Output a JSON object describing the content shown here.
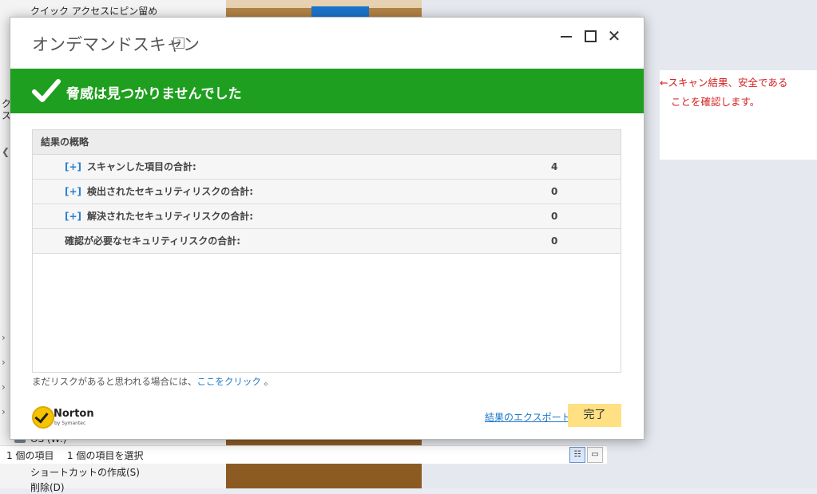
{
  "background": {
    "explorer_items": [
      "クイック アクセスにピン留め",
      "ク",
      "ス",
      "ショートカットの作成(S)",
      "削除(D)"
    ],
    "drive_label": "OS (W:)",
    "status_bar": {
      "item_count": "1 個の項目",
      "selected": "1 個の項目を選択"
    }
  },
  "annotation": {
    "line1": "←スキャン結果、安全である",
    "line2": "ことを確認します。"
  },
  "dialog": {
    "title": "オンデマンドスキャン",
    "help": "?",
    "close": "✕",
    "banner_text": "脅威は見つかりませんでした",
    "summary": {
      "header": "結果の概略",
      "rows": [
        {
          "expander": "[+]",
          "label": "スキャンした項目の合計:",
          "value": "4"
        },
        {
          "expander": "[+]",
          "label": "検出されたセキュリティリスクの合計:",
          "value": "0"
        },
        {
          "expander": "[+]",
          "label": "解決されたセキュリティリスクの合計:",
          "value": "0"
        },
        {
          "expander": "",
          "label": "確認が必要なセキュリティリスクの合計:",
          "value": "0"
        }
      ]
    },
    "footnote": {
      "text": "まだリスクがあると思われる場合には、",
      "link": "ここをクリック",
      "suffix": "。"
    },
    "logo": {
      "name": "Norton",
      "by": "by Symantec"
    },
    "export_link": "結果のエクスポート",
    "done_button": "完了"
  },
  "colors": {
    "banner": "#1f9f1f",
    "done_button": "#ffe082",
    "link": "#1e78c8",
    "annotation": "#d42020"
  }
}
